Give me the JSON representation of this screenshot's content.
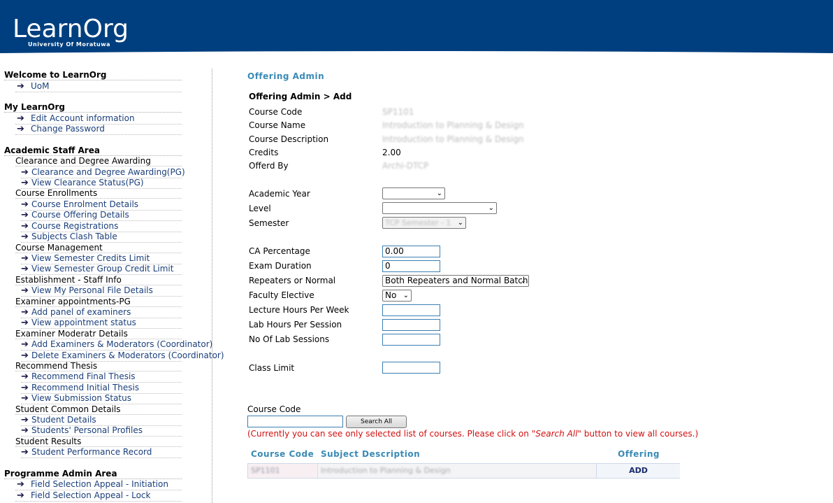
{
  "header": {
    "logo": "LearnOrg",
    "logo_sub": "University Of Moratuwa"
  },
  "sidebar": {
    "welcome_title": "Welcome to LearnOrg",
    "welcome_link": "UoM",
    "my_title": "My LearnOrg",
    "my_links": [
      "Edit Account information",
      "Change Password"
    ],
    "academic_title": "Academic Staff Area",
    "groups": [
      {
        "title": "Clearance and Degree Awarding",
        "links": [
          "Clearance and Degree Awarding(PG)",
          "View Clearance Status(PG)"
        ]
      },
      {
        "title": "Course Enrollments",
        "links": [
          "Course Enrolment Details",
          "Course Offering Details",
          "Course Registrations",
          "Subjects Clash Table"
        ]
      },
      {
        "title": "Course Management",
        "links": [
          "View Semester Credits Limit",
          "View Semester Group Credit Limit"
        ]
      },
      {
        "title": "Establishment - Staff Info",
        "links": [
          "View My Personal File Details"
        ]
      },
      {
        "title": "Examiner appointments-PG",
        "links": [
          "Add panel of examiners",
          "View appointment status"
        ]
      },
      {
        "title": "Examiner Moderatr Details",
        "links": [
          "Add Examiners & Moderators (Coordinator)",
          "Delete Examiners & Moderators (Coordinator)"
        ]
      },
      {
        "title": "Recommend Thesis",
        "links": [
          "Recommend Final Thesis",
          "Recommend Initial Thesis",
          "View Submission Status"
        ]
      },
      {
        "title": "Student Common Details",
        "links": [
          "Student Details",
          "Students' Personal Profiles"
        ]
      },
      {
        "title": "Student Results",
        "links": [
          "Student Performance Record"
        ]
      }
    ],
    "programme_title": "Programme Admin Area",
    "programme_links": [
      "Field Selection Appeal - Initiation",
      "Field Selection Appeal - Lock"
    ]
  },
  "main": {
    "page_title": "Offering Admin",
    "breadcrumb": "Offering Admin > Add",
    "course_code_label": "Course Code",
    "course_code_value": "SP1101",
    "course_name_label": "Course Name",
    "course_name_value": "Introduction to Planning & Design",
    "course_desc_label": "Course Description",
    "course_desc_value": "Introduction to Planning & Design",
    "credits_label": "Credits",
    "credits_value": "2.00",
    "offered_by_label": "Offerd By",
    "offered_by_value": "Archi-DTCP",
    "academic_year_label": "Academic Year",
    "level_label": "Level",
    "semester_label": "Semester",
    "semester_value": "TCP Semester - 1",
    "ca_label": "CA Percentage",
    "ca_value": "0.00",
    "exam_duration_label": "Exam Duration",
    "exam_duration_value": "0",
    "repeaters_label": "Repeaters or Normal",
    "repeaters_value": "Both Repeaters and Normal Batch",
    "faculty_elective_label": "Faculty Elective",
    "faculty_elective_value": "No",
    "lecture_hours_label": "Lecture Hours Per Week",
    "lab_hours_label": "Lab Hours Per Session",
    "lab_sessions_label": "No Of Lab Sessions",
    "class_limit_label": "Class Limit",
    "search_label": "Course Code",
    "search_button": "Search All",
    "notice_prefix": "(Currently you can see only selected list of courses. Please click on ",
    "notice_em": "\"Search All\"",
    "notice_suffix": " button to view all courses.)",
    "table": {
      "col_code": "Course Code",
      "col_desc": "Subject Description",
      "col_offering": "Offering",
      "row_code": "SP1101",
      "row_desc": "Introduction to Planning & Design",
      "row_action": "ADD"
    }
  }
}
